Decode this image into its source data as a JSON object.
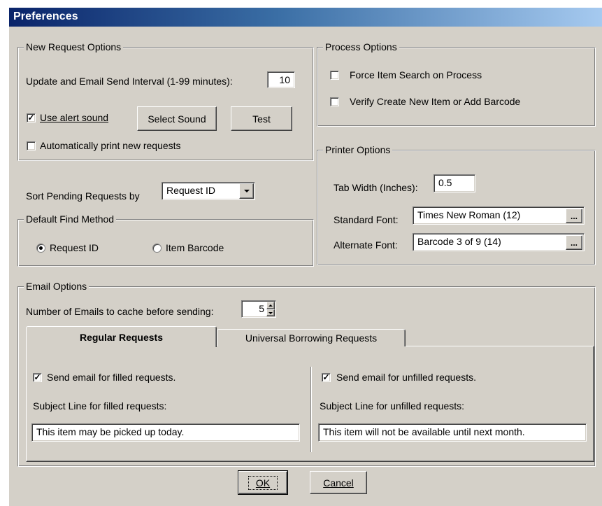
{
  "window": {
    "title": "Preferences"
  },
  "new_request": {
    "legend": "New Request Options",
    "interval_label": "Update and Email Send Interval (1-99 minutes):",
    "interval_value": "10",
    "alert_label": "Use alert sound",
    "alert_checked": true,
    "select_sound_label": "Select Sound",
    "test_label": "Test",
    "auto_print_label": "Automatically print new requests",
    "auto_print_checked": false
  },
  "sort": {
    "label": "Sort Pending Requests by",
    "value": "Request ID"
  },
  "find": {
    "legend": "Default Find Method",
    "options": [
      "Request ID",
      "Item Barcode"
    ],
    "selected": "Request ID"
  },
  "process": {
    "legend": "Process Options",
    "force_label": "Force Item Search on Process",
    "force_checked": false,
    "verify_label": "Verify Create New Item or Add Barcode",
    "verify_checked": false
  },
  "printer": {
    "legend": "Printer Options",
    "tab_width_label": "Tab Width (Inches):",
    "tab_width_value": "0.5",
    "standard_font_label": "Standard Font:",
    "standard_font_value": "Times New Roman (12)",
    "alternate_font_label": "Alternate Font:",
    "alternate_font_value": "Barcode 3 of 9 (14)",
    "browse_label": "..."
  },
  "email": {
    "legend": "Email Options",
    "cache_label": "Number of Emails to cache before sending:",
    "cache_value": "5",
    "tabs": [
      "Regular Requests",
      "Universal Borrowing Requests"
    ],
    "active_tab": "Regular Requests",
    "filled_check_label": "Send email for filled requests.",
    "filled_checked": true,
    "filled_subject_label": "Subject Line for filled requests:",
    "filled_subject_value": "This item may be picked up today.",
    "unfilled_check_label": "Send email for unfilled requests.",
    "unfilled_checked": true,
    "unfilled_subject_label": "Subject Line for unfilled requests:",
    "unfilled_subject_value": "This item will not be available until next month."
  },
  "buttons": {
    "ok": "OK",
    "cancel": "Cancel"
  },
  "icons": {
    "dropdown": "chevron-down-icon",
    "spin_up": "spin-up-icon",
    "spin_down": "spin-down-icon",
    "check": "checkmark-icon"
  }
}
